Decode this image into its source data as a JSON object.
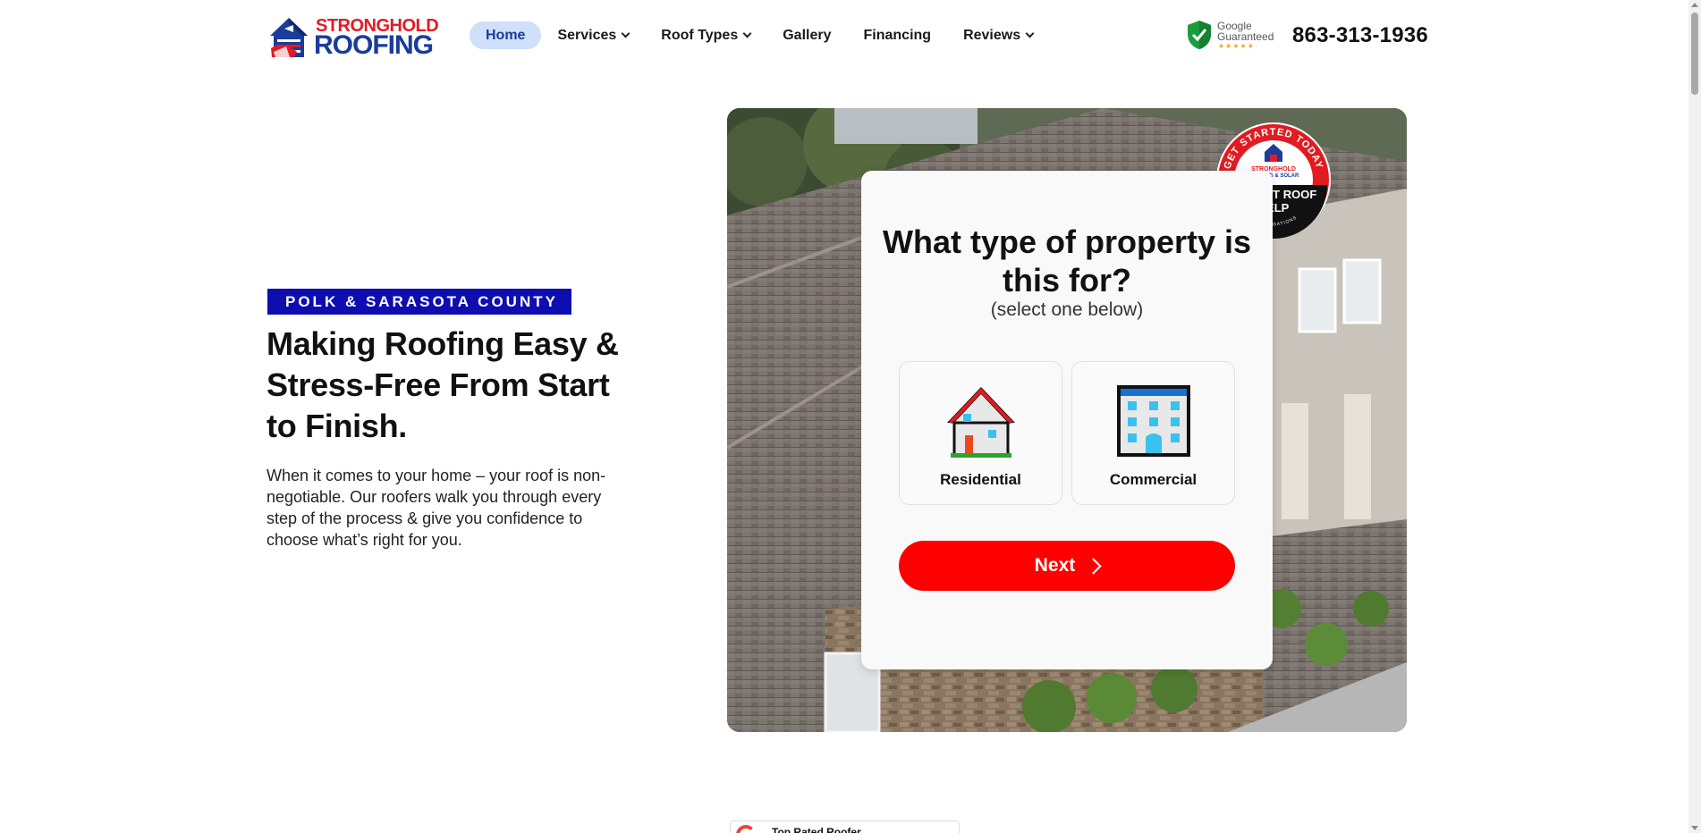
{
  "header": {
    "logo": {
      "line1": "STRONGHOLD",
      "line2": "ROOFING",
      "icon": "stronghold-house-flag-logo"
    },
    "nav": [
      {
        "label": "Home",
        "active": true,
        "dropdown": false
      },
      {
        "label": "Services",
        "active": false,
        "dropdown": true
      },
      {
        "label": "Roof Types",
        "active": false,
        "dropdown": true
      },
      {
        "label": "Gallery",
        "active": false,
        "dropdown": false
      },
      {
        "label": "Financing",
        "active": false,
        "dropdown": false
      },
      {
        "label": "Reviews",
        "active": false,
        "dropdown": true
      }
    ],
    "google_badge": {
      "line1": "Google",
      "line2": "Guaranteed",
      "stars": "★★★★★",
      "icon": "green-shield-check-icon"
    },
    "phone": "863-313-1936"
  },
  "hero": {
    "tag": "POLK & SARASOTA COUNTY",
    "title": "Making Roofing Easy & Stress-Free From Start to Finish.",
    "body": "When it comes to your home – your roof is non-negotiable. Our roofers walk you through every step of the process & give you confidence to choose what’s right for you."
  },
  "form": {
    "question": "What type of property is this for?",
    "subtext": "(select one below)",
    "options": [
      {
        "label": "Residential",
        "icon": "house-icon"
      },
      {
        "label": "Commercial",
        "icon": "office-building-icon"
      }
    ],
    "next_label": "Next"
  },
  "badge": {
    "arc_text": "GET STARTED TODAY",
    "brand_line1": "STRONGHOLD",
    "brand_line2": "ROOFING & SOLAR",
    "main_line1": "INSTANT ROOF",
    "main_line2": "HELP",
    "bottom_text": "NO OBLIGATIONS"
  },
  "review_card": {
    "title": "Top Rated Roofer"
  },
  "colors": {
    "brand_red": "#e11b22",
    "brand_blue": "#1a3c9a",
    "cta_red": "#ff0000",
    "tag_blue": "#0d0db0",
    "nav_active_bg": "#cfe0fb"
  }
}
